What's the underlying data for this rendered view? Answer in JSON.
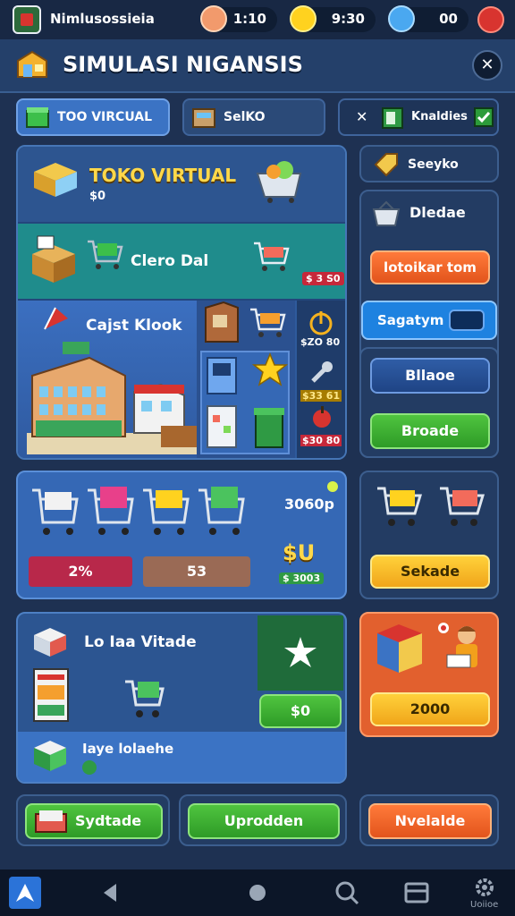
{
  "status": {
    "app_name": "Nimlusossieia",
    "lives": "1:10",
    "coins": "9:30",
    "gems": "00"
  },
  "header": {
    "title": "SIMULASI NIGANSIS",
    "close_label": "✕"
  },
  "tabs": [
    {
      "label": "TOO VIRCUAL"
    },
    {
      "label": "SelKO"
    },
    {
      "label": "Knaldies"
    }
  ],
  "featured": {
    "title": "TOKO VIRTUAL",
    "value": "$0",
    "row1_label": "Clero Dal",
    "row1_price": "$ 3 S0",
    "row2_label": "Cajst Klook",
    "prices": [
      "$ZO 80",
      "$33 61",
      "$30 80"
    ]
  },
  "sidebar": {
    "label": "Seeyko",
    "item_label": "Dledae",
    "btn_orange": "lotoikar tom",
    "btn_toggle": "Sagatym",
    "btn_blue": "Bllaoe",
    "btn_green": "Broade"
  },
  "carts_panel": {
    "amount": "3060p",
    "bar1": "2%",
    "bar2": "53",
    "currency": "$U",
    "sub_price": "$ 3003"
  },
  "carts_side": {
    "button": "Sekade"
  },
  "store_panel": {
    "title": "Lo Iaa Vitade",
    "price_btn": "$0",
    "sub_label": "Iaye lolaehe"
  },
  "promo": {
    "button": "2000"
  },
  "bottom_buttons": [
    "Sydtade",
    "Uprodden",
    "Nvelalde"
  ],
  "navbar": {
    "last_label": "Uoiioe"
  },
  "colors": {
    "background": "#1e3152",
    "accent_orange": "#e2541c",
    "accent_green": "#2e9b27",
    "accent_yellow": "#f0a51a"
  }
}
